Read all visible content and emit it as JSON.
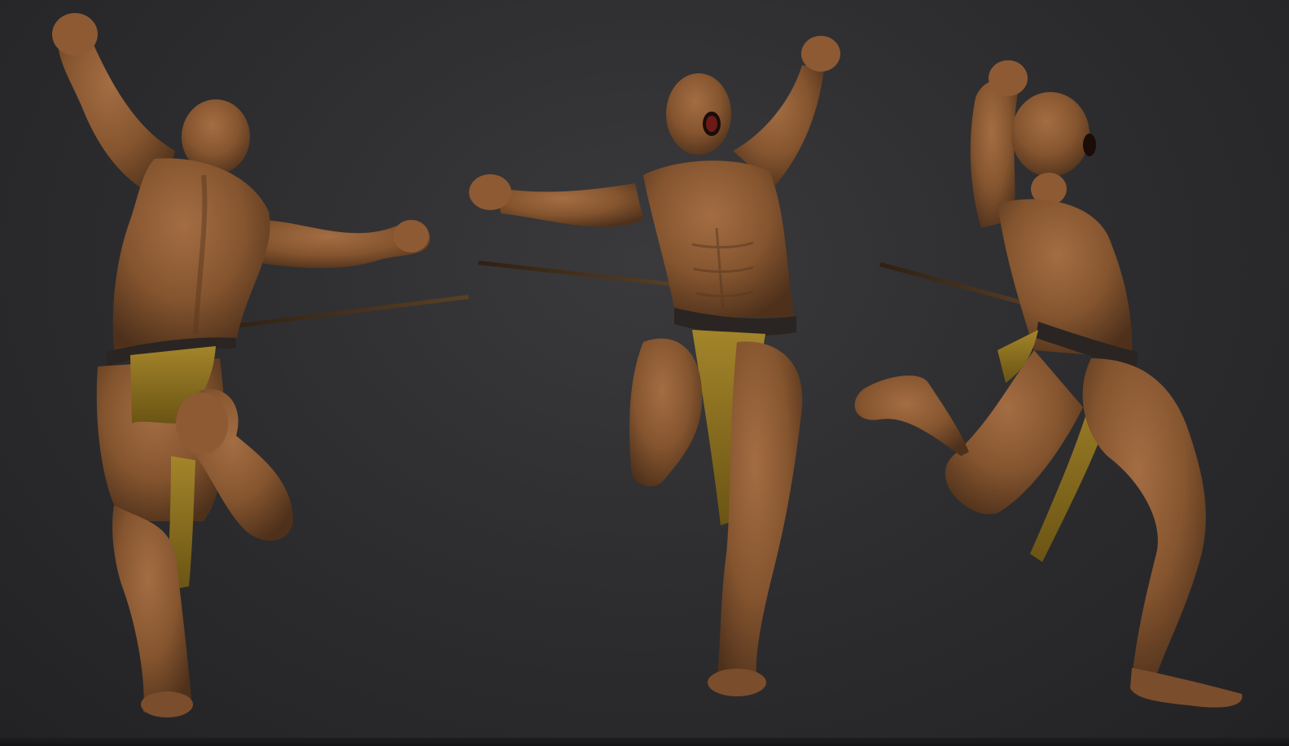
{
  "canvas": {
    "background_color": "#2f2f31",
    "skin_color": "#8a5a36",
    "skin_shadow_color": "#5a3820",
    "loincloth_color": "#8a6e1c",
    "belt_color": "#2a2522",
    "arrow_color": "#3e2c1a"
  },
  "figures": [
    {
      "name": "back-view",
      "description_icon": "figure-back-view-icon"
    },
    {
      "name": "front-view",
      "description_icon": "figure-front-view-icon"
    },
    {
      "name": "side-view",
      "description_icon": "figure-side-view-icon"
    }
  ]
}
